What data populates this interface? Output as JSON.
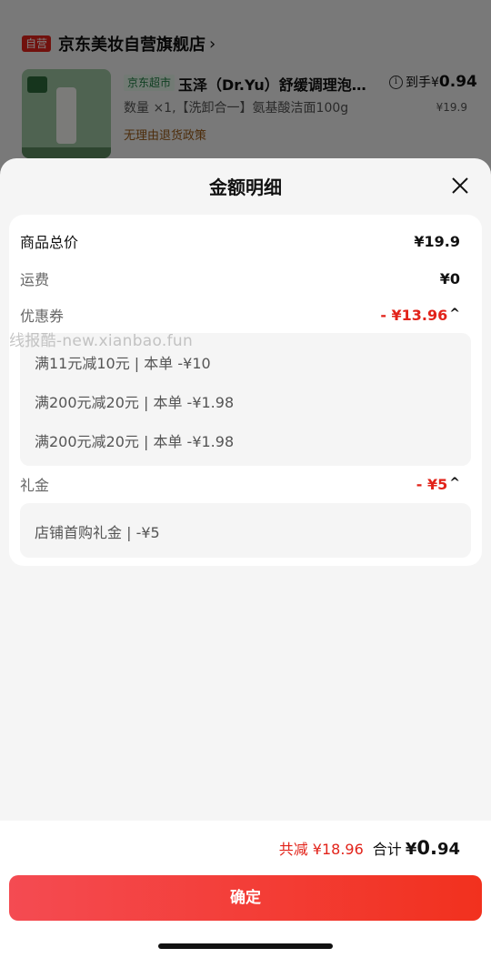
{
  "background": {
    "store": {
      "badge": "自营",
      "name": "京东美妆自营旗舰店",
      "arrow": "›"
    },
    "product": {
      "tag": "京东超市",
      "title": "玉泽（Dr.Yu）舒缓调理泡…",
      "info_icon": "i",
      "daoshou_label": "到手¥",
      "daoshou_int": "0.",
      "daoshou_dec": "94",
      "quantity_line": "数量 ×1,【洗卸合一】氨基酸洁面100g",
      "orig_price": "¥19.9",
      "return_policy": "无理由退货政策"
    }
  },
  "sheet": {
    "title": "金额明细",
    "close_icon": "close-icon",
    "rows": {
      "total": {
        "label": "商品总价",
        "value": "¥19.9"
      },
      "shipping": {
        "label": "运费",
        "value": "¥0"
      },
      "coupon": {
        "label": "优惠券",
        "value": "- ¥13.96",
        "caret": "^"
      },
      "gift": {
        "label": "礼金",
        "value": "- ¥5",
        "caret": "^"
      }
    },
    "coupon_items": [
      "满11元减10元 | 本单 -¥10",
      "满200元减20元 | 本单 -¥1.98",
      "满200元减20元 | 本单 -¥1.98"
    ],
    "gift_items": [
      "店铺首购礼金 | -¥5"
    ],
    "watermark": "线报酷-new.xianbao.fun"
  },
  "footer": {
    "saving": "共减 ¥18.96",
    "sum_label": "合计",
    "sum_currency": "¥",
    "sum_int": "0.",
    "sum_dec": "94",
    "confirm": "确定"
  },
  "colors": {
    "accent": "#e2231a",
    "button_start": "#f44b52",
    "button_end": "#f2311e"
  }
}
